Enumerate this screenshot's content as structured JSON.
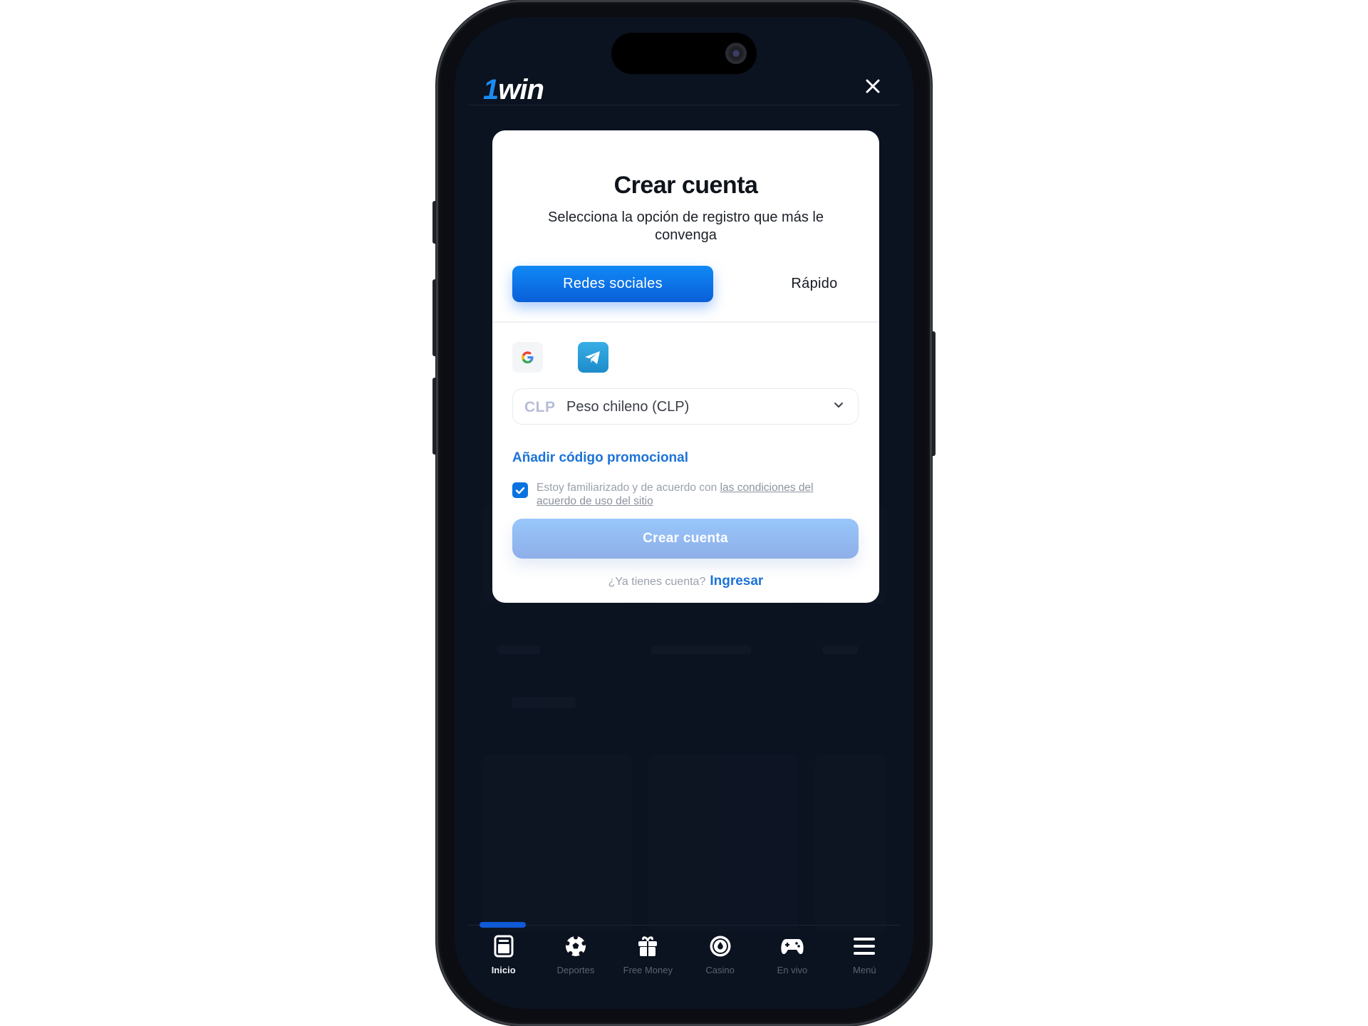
{
  "app": {
    "logo_prefix": "1",
    "logo_suffix": "win"
  },
  "modal": {
    "title": "Crear cuenta",
    "subtitle": "Selecciona la opción de registro que más le convenga",
    "tabs": [
      {
        "label": "Redes sociales",
        "active": true
      },
      {
        "label": "Rápido",
        "active": false
      }
    ],
    "social_providers": [
      {
        "name": "Google",
        "icon": "google-icon"
      },
      {
        "name": "Telegram",
        "icon": "telegram-icon"
      }
    ],
    "currency": {
      "code": "CLP",
      "name": "Peso chileno (CLP)"
    },
    "promo_label": "Añadir código promocional",
    "terms": {
      "checked": true,
      "text": "Estoy familiarizado y de acuerdo con ",
      "link": "las condiciones del acuerdo de uso del sitio"
    },
    "create_button": "Crear cuenta",
    "login_prompt": "¿Ya tienes cuenta?",
    "login_link": "Ingresar"
  },
  "colors": {
    "accent": "#0B73E0",
    "link": "#1C73D8",
    "screen_bg": "#0B1220",
    "disabled_button": "#98C7FB"
  },
  "tabbar": {
    "items": [
      {
        "label": "Inicio",
        "icon": "home-icon",
        "active": true
      },
      {
        "label": "Deportes",
        "icon": "soccer-ball-icon",
        "active": false
      },
      {
        "label": "Free Money",
        "icon": "gift-icon",
        "active": false
      },
      {
        "label": "Casino",
        "icon": "casino-chip-icon",
        "active": false
      },
      {
        "label": "En vivo",
        "icon": "gamepad-icon",
        "active": false
      },
      {
        "label": "Menú",
        "icon": "menu-icon",
        "active": false
      }
    ]
  }
}
